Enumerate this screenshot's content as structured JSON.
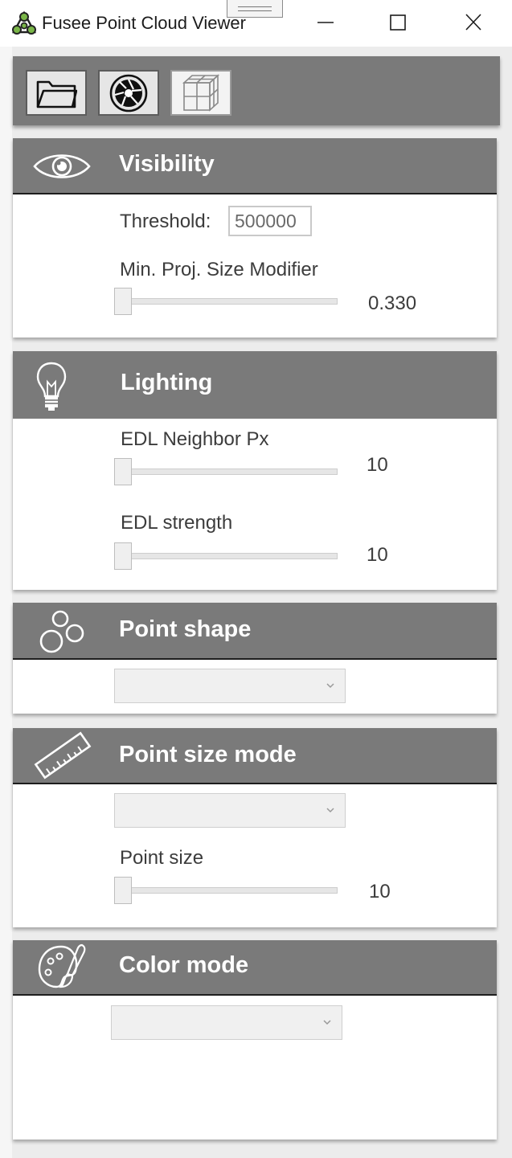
{
  "window": {
    "title": "Fusee Point Cloud Viewer"
  },
  "toolbar": {
    "buttons": [
      {
        "icon": "folder-open-icon"
      },
      {
        "icon": "camera-aperture-icon"
      },
      {
        "icon": "cube-icon",
        "active": true
      }
    ]
  },
  "visibility": {
    "title": "Visibility",
    "icon": "eye-icon",
    "threshold_label": "Threshold:",
    "threshold_value": "500000",
    "min_proj_label": "Min. Proj. Size Modifier",
    "min_proj_value": "0.330",
    "min_proj_position": 0
  },
  "lighting": {
    "title": "Lighting",
    "icon": "light-bulb-icon",
    "edl_neighbor_label": "EDL Neighbor Px",
    "edl_neighbor_value": "10",
    "edl_neighbor_position": 0,
    "edl_strength_label": "EDL strength",
    "edl_strength_value": "10",
    "edl_strength_position": 0
  },
  "point_shape": {
    "title": "Point shape",
    "icon": "circles-icon",
    "selected": ""
  },
  "point_size_mode": {
    "title": "Point size mode",
    "icon": "ruler-icon",
    "selected": "",
    "point_size_label": "Point size",
    "point_size_value": "10",
    "point_size_position": 0
  },
  "color_mode": {
    "title": "Color mode",
    "icon": "palette-icon",
    "selected": ""
  },
  "colors": {
    "header_bg": "#7a7a7a",
    "panel_bg": "#ececec",
    "section_bg": "#ffffff",
    "header_text": "#ffffff"
  }
}
